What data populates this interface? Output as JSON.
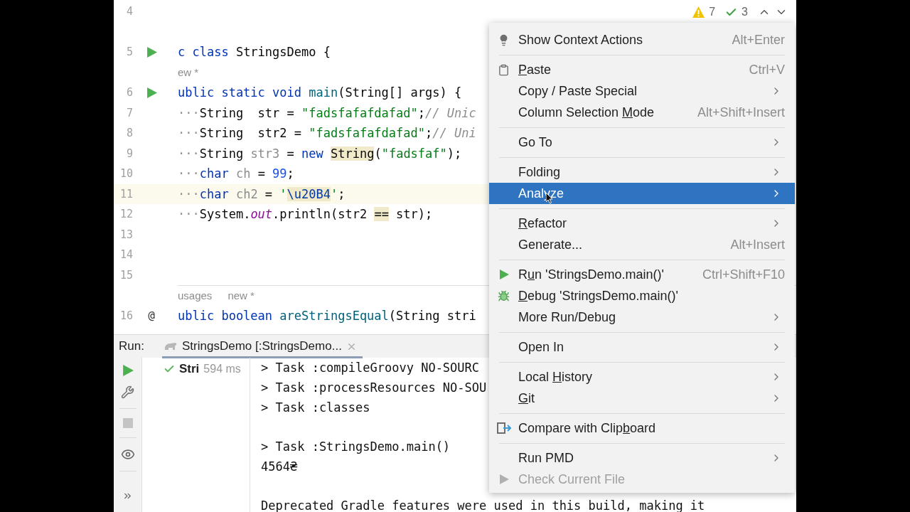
{
  "editor": {
    "inspections": {
      "warnings": "7",
      "typos": "3"
    },
    "lines": [
      {
        "kind": "code",
        "number": "4",
        "current": false,
        "runnable": false
      },
      {
        "kind": "code",
        "number": "5",
        "current": false,
        "runnable": true,
        "tokens": [
          {
            "kind": "kw",
            "text": "c class"
          },
          {
            "kind": "plain",
            "text": " StringsDemo {"
          }
        ]
      },
      {
        "kind": "hint",
        "texts": [
          "ew *"
        ]
      },
      {
        "kind": "code",
        "number": "6",
        "current": false,
        "runnable": true,
        "tokens": [
          {
            "kind": "kw",
            "text": "ublic static void "
          },
          {
            "kind": "fn",
            "text": "main"
          },
          {
            "kind": "plain",
            "text": "(String[] args) {"
          }
        ]
      },
      {
        "kind": "code",
        "number": "7",
        "current": false,
        "runnable": false,
        "tokens": [
          {
            "kind": "ws",
            "text": "···"
          },
          {
            "kind": "plain",
            "text": "String  str = "
          },
          {
            "kind": "str",
            "text": "\"fadsfafafdafad\""
          },
          {
            "kind": "plain",
            "text": ";"
          },
          {
            "kind": "comment",
            "text": "// Unic"
          }
        ]
      },
      {
        "kind": "code",
        "number": "8",
        "current": false,
        "runnable": false,
        "tokens": [
          {
            "kind": "ws",
            "text": "···"
          },
          {
            "kind": "plain",
            "text": "String  str2 = "
          },
          {
            "kind": "str",
            "text": "\"fadsfafafdafad\""
          },
          {
            "kind": "plain",
            "text": ";"
          },
          {
            "kind": "comment",
            "text": "// Uni"
          }
        ]
      },
      {
        "kind": "code",
        "number": "9",
        "current": false,
        "runnable": false,
        "tokens": [
          {
            "kind": "ws",
            "text": "···"
          },
          {
            "kind": "plain",
            "text": "String "
          },
          {
            "kind": "unused",
            "text": "str3"
          },
          {
            "kind": "plain",
            "text": " = "
          },
          {
            "kind": "kw",
            "text": "new "
          },
          {
            "kind": "plain",
            "text": "String",
            "highlight": true
          },
          {
            "kind": "plain",
            "text": "("
          },
          {
            "kind": "str",
            "text": "\"fadsfaf\""
          },
          {
            "kind": "plain",
            "text": ");"
          }
        ]
      },
      {
        "kind": "code",
        "number": "10",
        "current": false,
        "runnable": false,
        "tokens": [
          {
            "kind": "ws",
            "text": "···"
          },
          {
            "kind": "kw",
            "text": "char "
          },
          {
            "kind": "unused",
            "text": "ch"
          },
          {
            "kind": "plain",
            "text": " = "
          },
          {
            "kind": "num",
            "text": "99"
          },
          {
            "kind": "plain",
            "text": ";"
          }
        ]
      },
      {
        "kind": "code",
        "number": "11",
        "current": true,
        "runnable": false,
        "tokens": [
          {
            "kind": "ws",
            "text": "···"
          },
          {
            "kind": "kw",
            "text": "char "
          },
          {
            "kind": "unused",
            "text": "ch2"
          },
          {
            "kind": "plain",
            "text": " = "
          },
          {
            "kind": "str",
            "text": "'"
          },
          {
            "kind": "esc",
            "text": "\\u20B4",
            "highlight": true
          },
          {
            "kind": "str",
            "text": "'"
          },
          {
            "kind": "plain",
            "text": ";"
          }
        ]
      },
      {
        "kind": "code",
        "number": "12",
        "current": false,
        "runnable": false,
        "tokens": [
          {
            "kind": "ws",
            "text": "···"
          },
          {
            "kind": "plain",
            "text": "System."
          },
          {
            "kind": "field",
            "text": "out"
          },
          {
            "kind": "plain",
            "text": ".println(str2 "
          },
          {
            "kind": "plain",
            "text": "==",
            "highlight": true
          },
          {
            "kind": "plain",
            "text": " str);"
          }
        ]
      },
      {
        "kind": "code",
        "number": "13",
        "current": false,
        "runnable": false
      },
      {
        "kind": "code",
        "number": "14",
        "current": false,
        "runnable": false
      },
      {
        "kind": "code",
        "number": "15",
        "current": false,
        "runnable": false
      },
      {
        "kind": "hint",
        "texts": [
          "usages",
          "new *"
        ]
      },
      {
        "kind": "code",
        "number": "16",
        "current": false,
        "runnable": false,
        "marker_text": "@",
        "tokens": [
          {
            "kind": "kw",
            "text": "ublic boolean "
          },
          {
            "kind": "fn",
            "text": "areStringsEqual"
          },
          {
            "kind": "plain",
            "text": "(String stri"
          }
        ]
      }
    ]
  },
  "run_panel": {
    "label": "Run:",
    "tab": {
      "title": "StringsDemo [:StringsDemo...",
      "selected": true
    },
    "tree": [
      {
        "passed": true,
        "name": "Stri",
        "time": "594 ms"
      }
    ],
    "console": [
      [
        "> Task :compileGroovy NO-SOURC",
        "> Task :processResources NO-SOU",
        "> Task :classes"
      ],
      [
        "> Task :StringsDemo.main()",
        "4564₴"
      ],
      [
        "Deprecated Gradle features were used in this build, making it"
      ]
    ]
  },
  "context_menu": {
    "groups": [
      [
        {
          "kind": "context-action",
          "label": {
            "before": "Show Context Actions"
          },
          "shortcut": "Alt+Enter",
          "submenu": false,
          "selected": false,
          "disabled": false
        }
      ],
      [
        {
          "kind": "paste",
          "label": {
            "mnemonic": "P",
            "after": "aste"
          },
          "shortcut": "Ctrl+V",
          "submenu": false,
          "selected": false,
          "disabled": false
        },
        {
          "kind": "plain",
          "label": {
            "before": "Copy / Paste Special"
          },
          "submenu": true,
          "selected": false,
          "disabled": false
        },
        {
          "kind": "plain",
          "label": {
            "before": "Column Selection ",
            "mnemonic": "M",
            "after": "ode"
          },
          "shortcut": "Alt+Shift+Insert",
          "submenu": false,
          "selected": false,
          "disabled": false
        }
      ],
      [
        {
          "kind": "plain",
          "label": {
            "before": "Go To"
          },
          "submenu": true,
          "selected": false,
          "disabled": false
        }
      ],
      [
        {
          "kind": "plain",
          "label": {
            "before": "Folding"
          },
          "submenu": true,
          "selected": false,
          "disabled": false
        },
        {
          "kind": "plain",
          "label": {
            "before": "Analyze"
          },
          "submenu": true,
          "selected": true,
          "disabled": false
        }
      ],
      [
        {
          "kind": "plain",
          "label": {
            "mnemonic": "R",
            "after": "efactor"
          },
          "submenu": true,
          "selected": false,
          "disabled": false
        },
        {
          "kind": "plain",
          "label": {
            "before": "Generate..."
          },
          "shortcut": "Alt+Insert",
          "submenu": false,
          "selected": false,
          "disabled": false
        }
      ],
      [
        {
          "kind": "run",
          "label": {
            "before": "R",
            "mnemonic": "u",
            "after": "n 'StringsDemo.main()'"
          },
          "shortcut": "Ctrl+Shift+F10",
          "submenu": false,
          "selected": false,
          "disabled": false
        },
        {
          "kind": "debug",
          "label": {
            "mnemonic": "D",
            "after": "ebug 'StringsDemo.main()'"
          },
          "submenu": false,
          "selected": false,
          "disabled": false
        },
        {
          "kind": "plain",
          "label": {
            "before": "More Run/Debug"
          },
          "submenu": true,
          "selected": false,
          "disabled": false
        }
      ],
      [
        {
          "kind": "plain",
          "label": {
            "before": "Open In"
          },
          "submenu": true,
          "selected": false,
          "disabled": false
        }
      ],
      [
        {
          "kind": "plain",
          "label": {
            "before": "Local ",
            "mnemonic": "H",
            "after": "istory"
          },
          "submenu": true,
          "selected": false,
          "disabled": false
        },
        {
          "kind": "plain",
          "label": {
            "mnemonic": "G",
            "after": "it"
          },
          "submenu": true,
          "selected": false,
          "disabled": false
        }
      ],
      [
        {
          "kind": "compare",
          "label": {
            "before": "Compare with Clip",
            "mnemonic": "b",
            "after": "oard"
          },
          "submenu": false,
          "selected": false,
          "disabled": false
        }
      ],
      [
        {
          "kind": "plain",
          "label": {
            "before": "Run PMD"
          },
          "submenu": true,
          "selected": false,
          "disabled": false
        },
        {
          "kind": "run",
          "label": {
            "before": "Check Current File"
          },
          "submenu": false,
          "selected": false,
          "disabled": true
        }
      ]
    ]
  }
}
